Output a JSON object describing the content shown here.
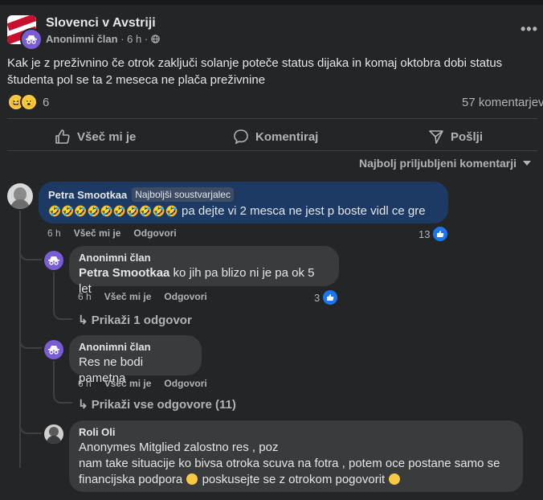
{
  "post": {
    "group_name": "Slovenci v Avstriji",
    "author": "Anonimni član",
    "time": "6 h",
    "separator": "·",
    "text": "Kak je z preživnino če otrok zaključi solanje poteče status dijaka in  komaj oktobra dobi status študenta pol se ta 2 meseca ne plača preživnine",
    "reaction_count": "6",
    "comment_count": "57 komentarjev",
    "more": "•••"
  },
  "actions": {
    "like": "Všeč mi je",
    "comment": "Komentiraj",
    "share": "Pošlji"
  },
  "sort_label": "Najbolj priljubljeni komentarji",
  "comments": [
    {
      "author": "Petra Smootkaa",
      "badge": "Najboljši soustvarjalec",
      "emojis": "🤣🤣🤣🤣🤣🤣🤣🤣🤣🤣",
      "text": " pa dejte vi 2 mesca ne jest p boste vidl ce gre",
      "time": "6 h",
      "like_label": "Všeč mi je",
      "reply_label": "Odgovori",
      "likes": "13"
    },
    {
      "author": "Anonimni član",
      "mention": "Petra Smootkaa",
      "text": " ko jih pa blizo ni je pa ok 5 let",
      "time": "6 h",
      "like_label": "Všeč mi je",
      "reply_label": "Odgovori",
      "likes": "3",
      "replies_link": "Prikaži 1 odgovor"
    },
    {
      "author": "Anonimni član",
      "text": "Res ne bodi pametna",
      "time": "6 h",
      "like_label": "Všeč mi je",
      "reply_label": "Odgovori",
      "replies_link": "Prikaži vse odgovore (11)"
    },
    {
      "author": "Roli Oli",
      "line1": "Anonymes Mitglied zalostno res , poz",
      "line2": "nam take situacije ko bivsa otroka scuva na fotra , potem oce postane samo se",
      "line3a": "financijska podpora ",
      "line3b": " poskusejte se z otrokom pogovorit "
    }
  ],
  "colors": {
    "background": "#242526",
    "bubble": "#3a3b3c",
    "accent_like": "#1877f2",
    "anon_avatar": "#7a5cd6",
    "highlight_bubble": "#1c3a63"
  },
  "icons": [
    "anonymous-icon",
    "globe-icon",
    "like-icon",
    "comment-icon",
    "share-icon",
    "reply-arrow-icon",
    "thumbs-up-icon",
    "more-icon"
  ]
}
